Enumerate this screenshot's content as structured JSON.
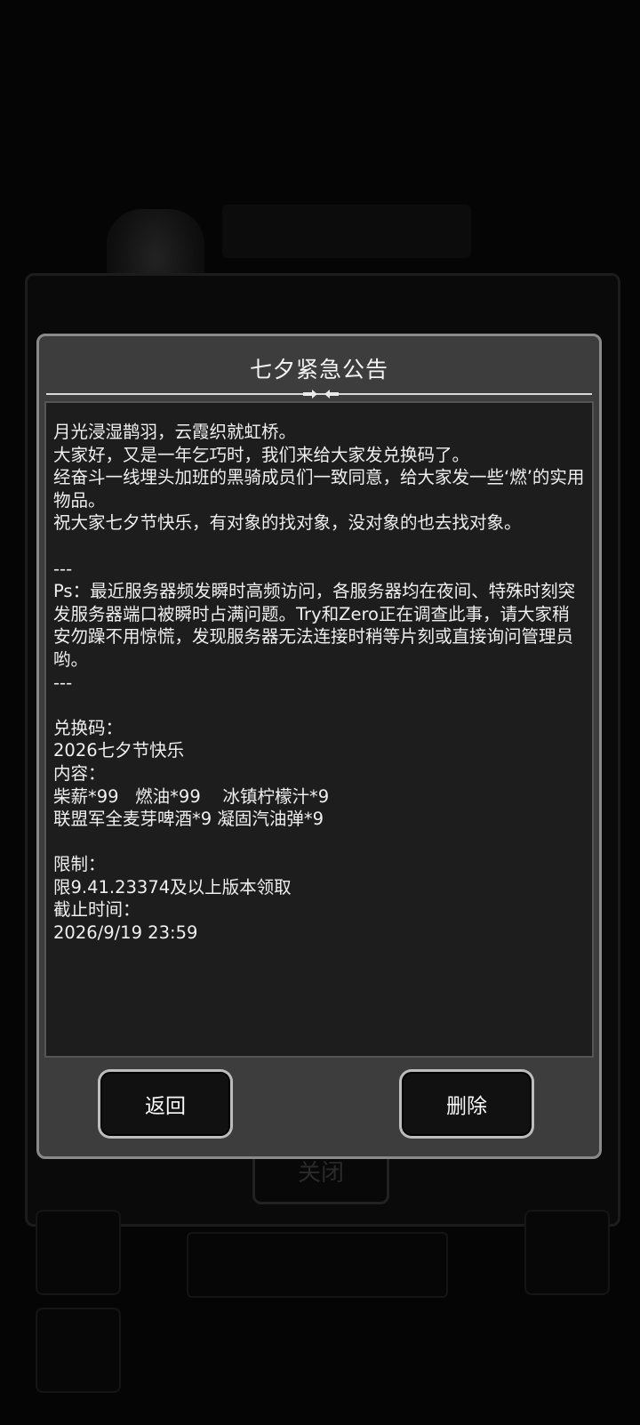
{
  "background": {
    "close_label": "关闭"
  },
  "dialog": {
    "title": "七夕紧急公告",
    "body": "月光浸湿鹊羽，云霞织就虹桥。\n大家好，又是一年乞巧时，我们来给大家发兑换码了。\n经奋斗一线埋头加班的黑骑成员们一致同意，给大家发一些‘燃’的实用物品。\n祝大家七夕节快乐，有对象的找对象，没对象的也去找对象。\n\n---\nPs：最近服务器频发瞬时高频访问，各服务器均在夜间、特殊时刻突发服务器端口被瞬时占满问题。Try和Zero正在调查此事，请大家稍安勿躁不用惊慌，发现服务器无法连接时稍等片刻或直接询问管理员哟。\n---\n\n兑换码：\n2026七夕节快乐\n内容：\n柴薪*99   燃油*99    冰镇柠檬汁*9\n联盟军全麦芽啤酒*9 凝固汽油弹*9\n\n限制：\n限9.41.23374及以上版本领取\n截止时间：\n2026/9/19 23:59",
    "back_label": "返回",
    "delete_label": "删除"
  }
}
